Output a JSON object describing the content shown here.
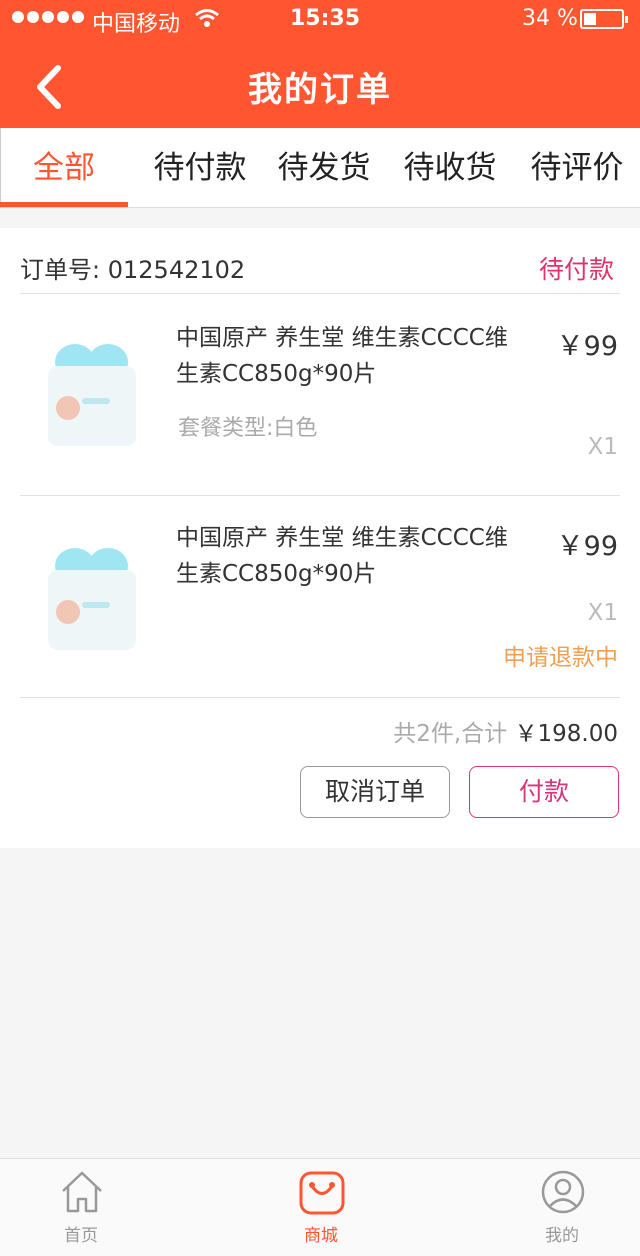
{
  "status_bar": {
    "carrier": "中国移动",
    "time": "15:35",
    "battery": "34 %"
  },
  "header": {
    "title": "我的订单"
  },
  "tabs": [
    {
      "label": "全部",
      "active": true
    },
    {
      "label": "待付款"
    },
    {
      "label": "待发货"
    },
    {
      "label": "待收货"
    },
    {
      "label": "待评价"
    }
  ],
  "order": {
    "number_label": "订单号:",
    "number": "012542102",
    "status": "待付款",
    "items": [
      {
        "name": "中国原产 养生堂 维生素CCCC维生素CC850g*90片",
        "spec": "套餐类型:白色",
        "price": "￥99",
        "qty": "X1",
        "note": ""
      },
      {
        "name": "中国原产 养生堂 维生素CCCC维生素CC850g*90片",
        "spec": "",
        "price": "￥99",
        "qty": "X1",
        "note": "申请退款中"
      }
    ],
    "summary_count": "共2件,合计",
    "summary_total": "￥198.00",
    "cancel_label": "取消订单",
    "pay_label": "付款"
  },
  "bottom_nav": [
    {
      "label": "首页",
      "icon": "home-icon"
    },
    {
      "label": "商城",
      "icon": "shop-icon",
      "active": true
    },
    {
      "label": "我的",
      "icon": "user-icon"
    }
  ],
  "colors": {
    "brand": "#ff5530",
    "pink": "#e0336b",
    "refund": "#f0a050"
  }
}
